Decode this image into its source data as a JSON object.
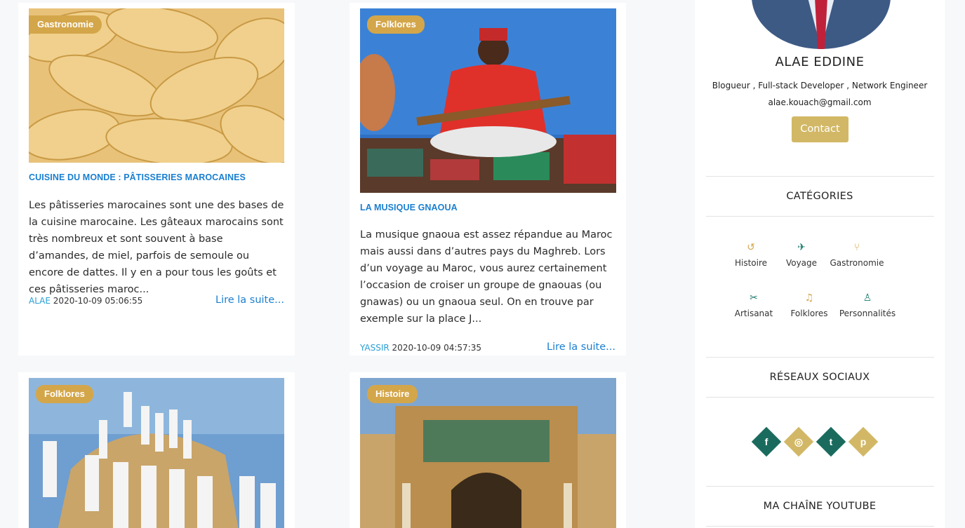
{
  "posts": [
    {
      "category": "Gastronomie",
      "title": "CUISINE DU MONDE : PÂTISSERIES MAROCAINES",
      "excerpt": "Les pâtisseries marocaines sont une des bases de la cuisine marocaine. Les gâteaux marocains sont très nombreux et sont souvent à base d’amandes, de miel, parfois de semoule ou encore de dattes. Il y en a pour tous les goûts et ces pâtisseries maroc...",
      "author": "ALAE",
      "date": "2020-10-09 05:06:55",
      "read_more": "Lire la suite..."
    },
    {
      "category": "Folklores",
      "title": "LA MUSIQUE GNAOUA",
      "excerpt": "La musique gnaoua est assez répandue au Maroc mais aussi dans d’autres pays du Maghreb. Lors d’un voyage au Maroc, vous aurez certainement l’occasion de croiser un groupe de gnaouas (ou gnawas) ou un gnaoua seul. On en trouve par exemple sur la place J...",
      "author": "YASSIR",
      "date": "2020-10-09 04:57:35",
      "read_more": "Lire la suite..."
    },
    {
      "category": "Folklores"
    },
    {
      "category": "Histoire"
    }
  ],
  "profile": {
    "name": "ALAE EDDINE",
    "role": "Blogueur , Full-stack Developer , Network Engineer",
    "email": "alae.kouach@gmail.com",
    "contact_label": "Contact"
  },
  "categories_section": {
    "title": "CATÉGORIES",
    "items": [
      {
        "label": "Histoire",
        "icon": "history-icon",
        "color": "#d4a64a"
      },
      {
        "label": "Voyage",
        "icon": "plane-icon",
        "color": "#1a7a6a"
      },
      {
        "label": "Gastronomie",
        "icon": "cutlery-icon",
        "color": "#d4a64a"
      },
      {
        "label": "Artisanat",
        "icon": "scissors-icon",
        "color": "#1a7a6a"
      },
      {
        "label": "Folklores",
        "icon": "music-icon",
        "color": "#d4a64a"
      },
      {
        "label": "Personnalités",
        "icon": "person-icon",
        "color": "#1a7a6a"
      }
    ]
  },
  "social_section": {
    "title": "RÉSEAUX SOCIAUX",
    "items": [
      {
        "icon": "facebook-icon",
        "glyph": "f",
        "color": "#1a6b5e"
      },
      {
        "icon": "instagram-icon",
        "glyph": "◎",
        "color": "#d2b866"
      },
      {
        "icon": "twitter-icon",
        "glyph": "t",
        "color": "#1a6b5e"
      },
      {
        "icon": "pinterest-icon",
        "glyph": "p",
        "color": "#d2b866"
      }
    ]
  },
  "youtube_section": {
    "title": "MA CHAÎNE YOUTUBE"
  },
  "colors": {
    "accent_gold": "#d4a64a",
    "link_blue": "#1a7fd0",
    "teal": "#1a6b5e",
    "button_gold": "#d2b866"
  }
}
